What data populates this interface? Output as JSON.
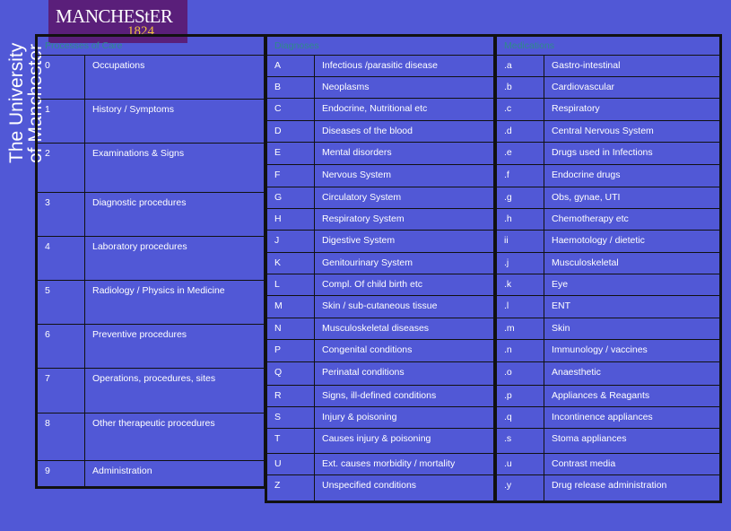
{
  "logo": {
    "word": "MANCHEStER",
    "year": "1824"
  },
  "university": {
    "line1": "The University",
    "line2": "of Manchester"
  },
  "table1": {
    "header": "Processes of Care",
    "rows": [
      {
        "code": "0",
        "label": "Occupations"
      },
      {
        "code": "1",
        "label": "History / Symptoms"
      },
      {
        "code": "2",
        "label": "Examinations & Signs"
      },
      {
        "code": "3",
        "label": "Diagnostic procedures"
      },
      {
        "code": "4",
        "label": "Laboratory procedures"
      },
      {
        "code": "5",
        "label": "Radiology / Physics in Medicine"
      },
      {
        "code": "6",
        "label": "Preventive procedures"
      },
      {
        "code": "7",
        "label": "Operations, procedures, sites"
      },
      {
        "code": "8",
        "label": "Other therapeutic procedures"
      },
      {
        "code": "9",
        "label": "Administration"
      }
    ]
  },
  "table2": {
    "header": "Diagnoses",
    "rows": [
      {
        "code": "A",
        "label": "Infectious /parasitic disease"
      },
      {
        "code": "B",
        "label": "Neoplasms"
      },
      {
        "code": "C",
        "label": "Endocrine, Nutritional etc"
      },
      {
        "code": "D",
        "label": "Diseases of the blood"
      },
      {
        "code": "E",
        "label": "Mental disorders"
      },
      {
        "code": "F",
        "label": "Nervous System"
      },
      {
        "code": "G",
        "label": "Circulatory System"
      },
      {
        "code": "H",
        "label": "Respiratory System"
      },
      {
        "code": "J",
        "label": "Digestive System"
      },
      {
        "code": "K",
        "label": "Genitourinary System"
      },
      {
        "code": "L",
        "label": "Compl. Of child birth etc"
      },
      {
        "code": "M",
        "label": "Skin / sub-cutaneous tissue"
      },
      {
        "code": "N",
        "label": "Musculoskeletal diseases"
      },
      {
        "code": "P",
        "label": "Congenital conditions"
      },
      {
        "code": "Q",
        "label": "Perinatal conditions"
      },
      {
        "code": "R",
        "label": "Signs, ill-defined conditions"
      },
      {
        "code": "S",
        "label": "Injury & poisoning"
      },
      {
        "code": "T",
        "label": "Causes injury & poisoning"
      },
      {
        "code": "U",
        "label": "Ext. causes morbidity / mortality"
      },
      {
        "code": "Z",
        "label": "Unspecified conditions"
      }
    ]
  },
  "table3": {
    "header": "Medications",
    "rows": [
      {
        "code": ".a",
        "label": "Gastro-intestinal"
      },
      {
        "code": ".b",
        "label": "Cardiovascular"
      },
      {
        "code": ".c",
        "label": "Respiratory"
      },
      {
        "code": ".d",
        "label": "Central Nervous System"
      },
      {
        "code": ".e",
        "label": "Drugs used in Infections"
      },
      {
        "code": ".f",
        "label": "Endocrine drugs"
      },
      {
        "code": ".g",
        "label": "Obs, gynae, UTI"
      },
      {
        "code": ".h",
        "label": "Chemotherapy etc"
      },
      {
        "code": "ii",
        "label": "Haemotology / dietetic"
      },
      {
        "code": ".j",
        "label": "Musculoskeletal"
      },
      {
        "code": ".k",
        "label": "Eye"
      },
      {
        "code": ".l",
        "label": "ENT"
      },
      {
        "code": ".m",
        "label": "Skin"
      },
      {
        "code": ".n",
        "label": "Immunology / vaccines"
      },
      {
        "code": ".o",
        "label": "Anaesthetic"
      },
      {
        "code": ".p",
        "label": "Appliances & Reagants"
      },
      {
        "code": ".q",
        "label": "Incontinence appliances"
      },
      {
        "code": ".s",
        "label": "Stoma appliances"
      },
      {
        "code": ".u",
        "label": "Contrast media"
      },
      {
        "code": ".y",
        "label": "Drug release administration"
      }
    ]
  }
}
